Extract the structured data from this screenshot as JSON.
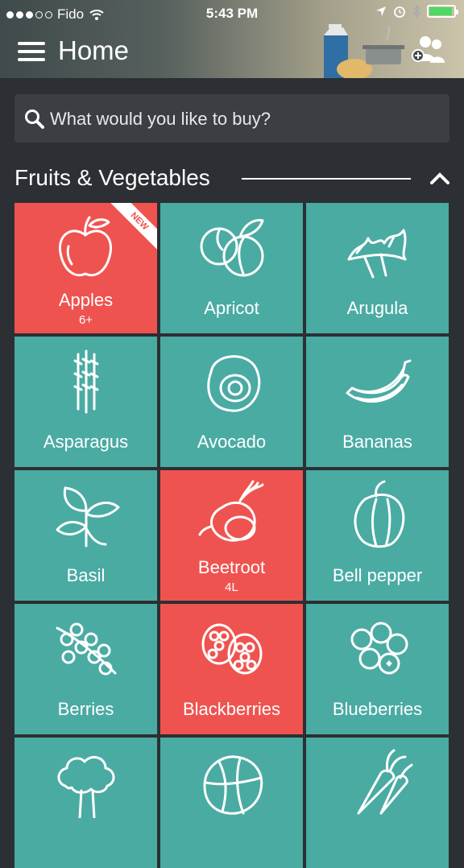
{
  "status": {
    "carrier": "Fido",
    "time": "5:43 PM"
  },
  "header": {
    "title": "Home"
  },
  "search": {
    "placeholder": "What would you like to buy?"
  },
  "section": {
    "title": "Fruits & Vegetables"
  },
  "colors": {
    "teal": "#4aaba3",
    "red": "#ef5350",
    "dark": "#2c2f33",
    "search_bg": "#3b3f44"
  },
  "items": [
    {
      "label": "Apples",
      "sub": "6+",
      "badge": "NEW",
      "selected": true,
      "icon": "apple-icon"
    },
    {
      "label": "Apricot",
      "sub": "",
      "badge": "",
      "selected": false,
      "icon": "apricot-icon"
    },
    {
      "label": "Arugula",
      "sub": "",
      "badge": "",
      "selected": false,
      "icon": "arugula-icon"
    },
    {
      "label": "Asparagus",
      "sub": "",
      "badge": "",
      "selected": false,
      "icon": "asparagus-icon"
    },
    {
      "label": "Avocado",
      "sub": "",
      "badge": "",
      "selected": false,
      "icon": "avocado-icon"
    },
    {
      "label": "Bananas",
      "sub": "",
      "badge": "",
      "selected": false,
      "icon": "banana-icon"
    },
    {
      "label": "Basil",
      "sub": "",
      "badge": "",
      "selected": false,
      "icon": "basil-icon"
    },
    {
      "label": "Beetroot",
      "sub": "4L",
      "badge": "",
      "selected": true,
      "icon": "beetroot-icon"
    },
    {
      "label": "Bell pepper",
      "sub": "",
      "badge": "",
      "selected": false,
      "icon": "bell-pepper-icon"
    },
    {
      "label": "Berries",
      "sub": "",
      "badge": "",
      "selected": false,
      "icon": "berries-icon"
    },
    {
      "label": "Blackberries",
      "sub": "",
      "badge": "",
      "selected": true,
      "icon": "blackberry-icon"
    },
    {
      "label": "Blueberries",
      "sub": "",
      "badge": "",
      "selected": false,
      "icon": "blueberry-icon"
    },
    {
      "label": "",
      "sub": "",
      "badge": "",
      "selected": false,
      "icon": "broccoli-icon"
    },
    {
      "label": "",
      "sub": "",
      "badge": "",
      "selected": false,
      "icon": "cabbage-icon"
    },
    {
      "label": "",
      "sub": "",
      "badge": "",
      "selected": false,
      "icon": "carrot-icon"
    }
  ]
}
